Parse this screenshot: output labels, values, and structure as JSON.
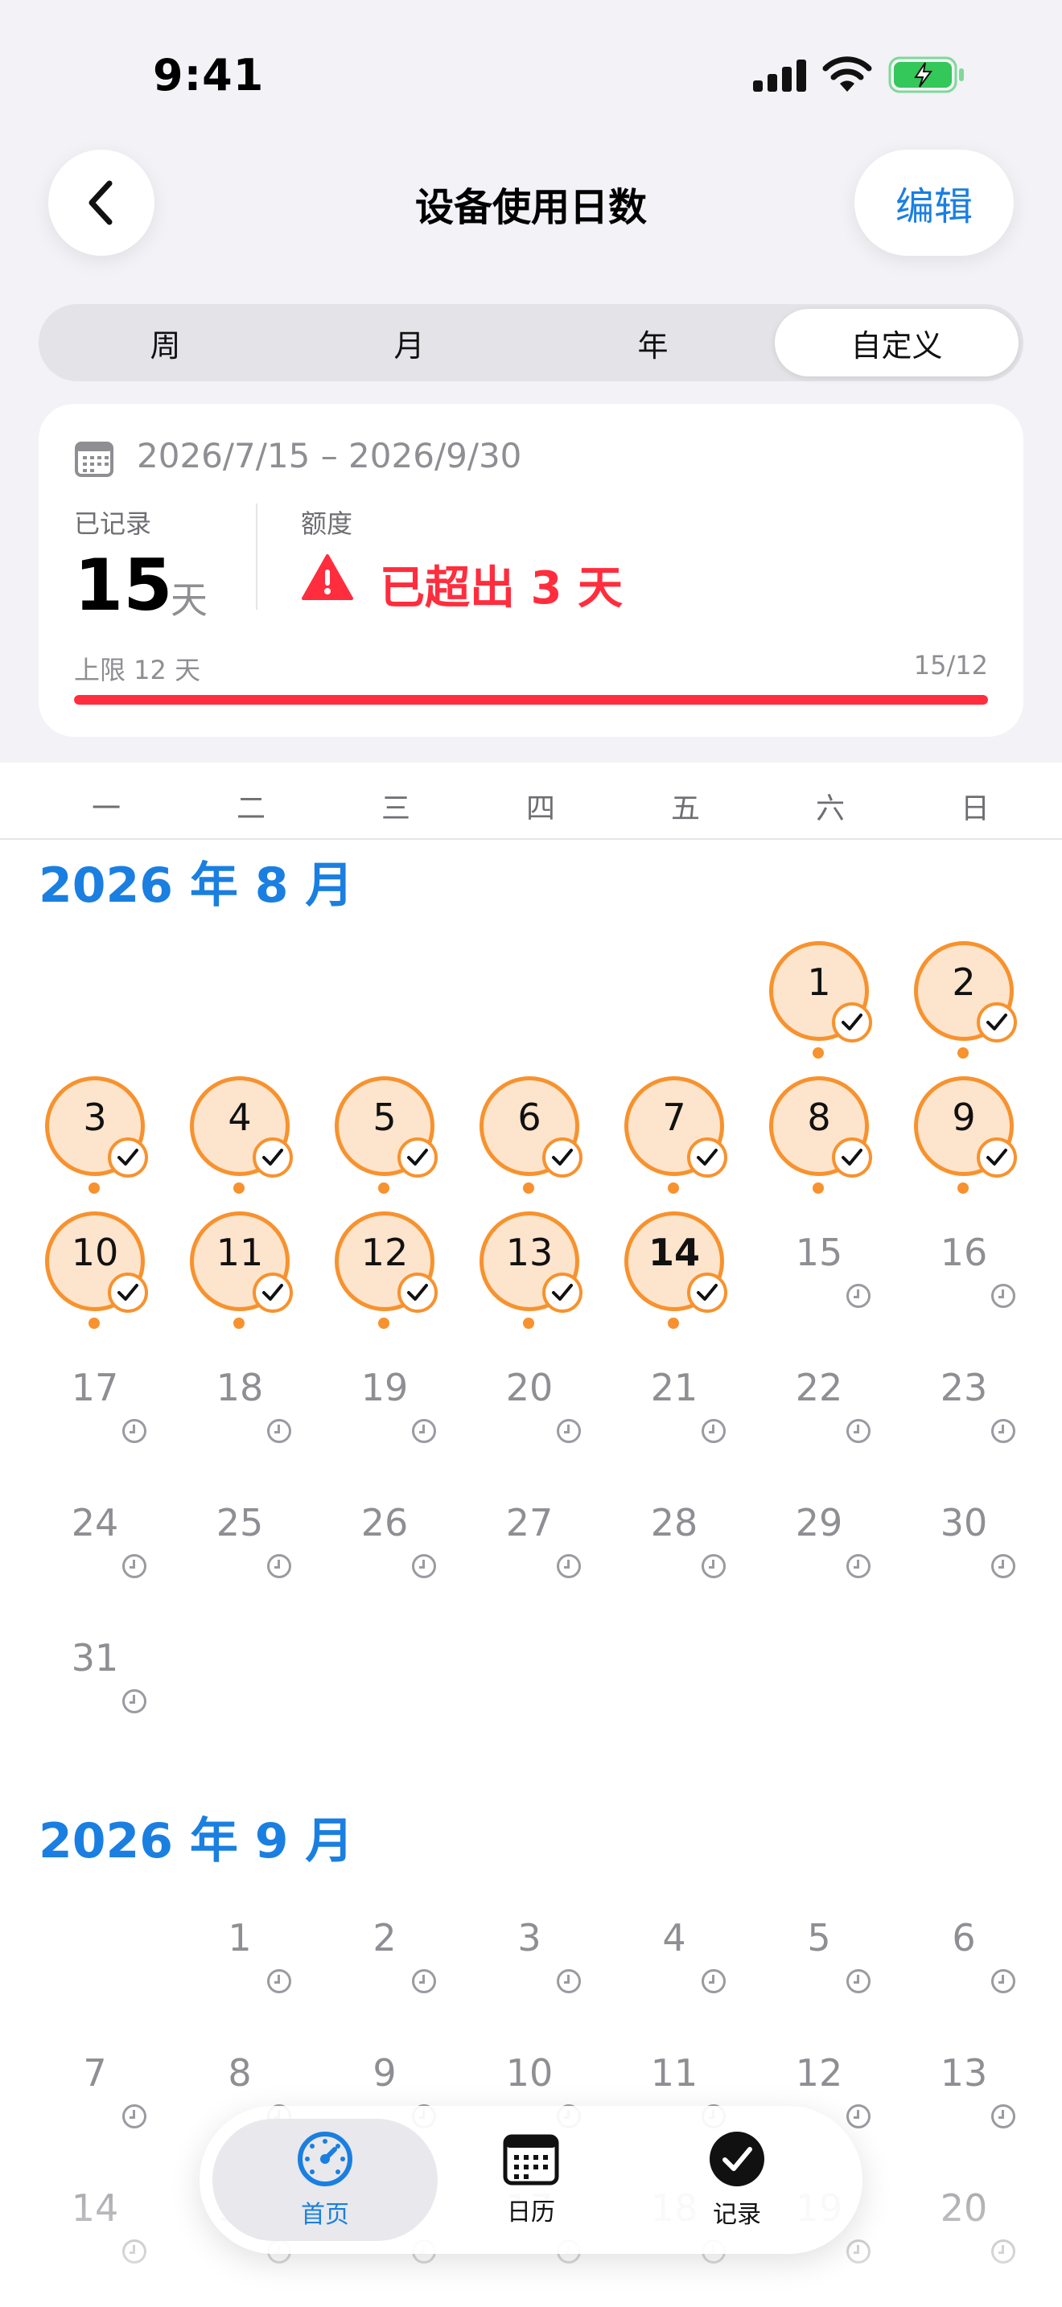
{
  "status_bar": {
    "time": "9:41"
  },
  "header": {
    "title": "设备使用日数",
    "edit_label": "编辑"
  },
  "segments": [
    {
      "label": "周",
      "active": false
    },
    {
      "label": "月",
      "active": false
    },
    {
      "label": "年",
      "active": false
    },
    {
      "label": "自定义",
      "active": true
    }
  ],
  "summary": {
    "range": "2026/7/15 – 2026/9/30",
    "recorded_label": "已记录",
    "recorded_value": "15",
    "recorded_unit": "天",
    "quota_label": "额度",
    "quota_status": "已超出 3 天",
    "limit_label": "上限 12 天",
    "ratio": "15/12",
    "progress": 1.0
  },
  "weekdays": [
    "一",
    "二",
    "三",
    "四",
    "五",
    "六",
    "日"
  ],
  "months": [
    {
      "title": "2026 年 8 月",
      "first_weekday": 5,
      "days": 31,
      "logged_through": 14,
      "today": 14
    },
    {
      "title": "2026 年 9 月",
      "first_weekday": 1,
      "days": 20,
      "logged_through": 0,
      "today": 0
    }
  ],
  "tabbar": [
    {
      "label": "首页",
      "icon": "gauge-icon",
      "active": true
    },
    {
      "label": "日历",
      "icon": "calendar-icon",
      "active": false
    },
    {
      "label": "记录",
      "icon": "checkmark-circle-icon",
      "active": false
    }
  ],
  "colors": {
    "accent": "#1a7fe0",
    "logged": "#f7922e",
    "logged_fill": "#fde4cc",
    "alert": "#ff2d3d"
  }
}
